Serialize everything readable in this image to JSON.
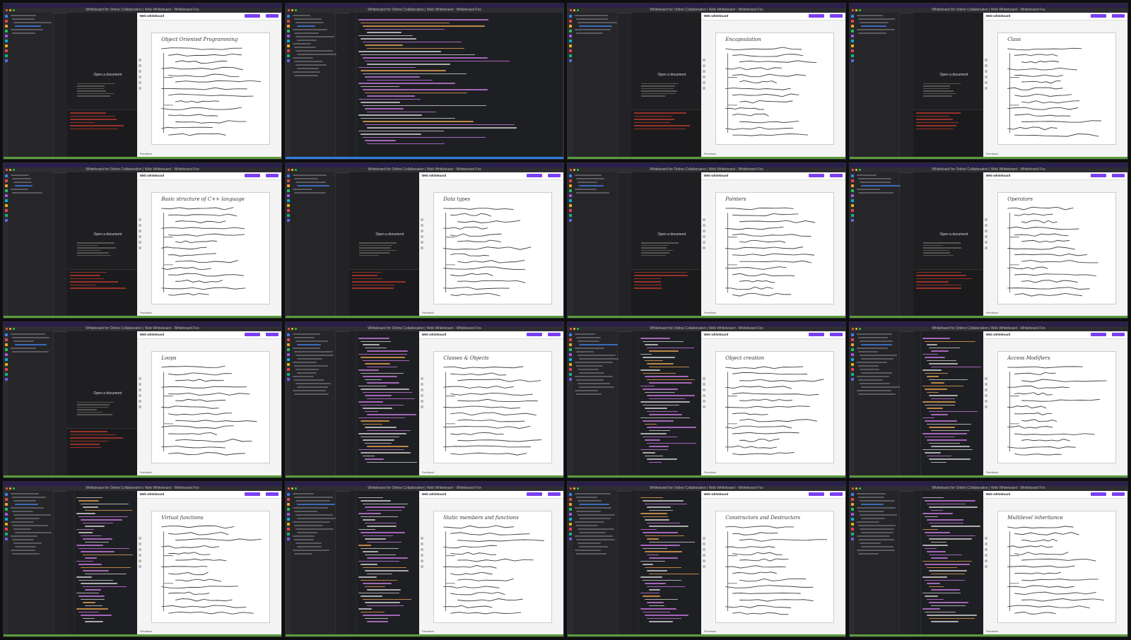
{
  "window_title": "Whiteboard for Online Collaboration | Web Whiteboard - Whiteboard Fox",
  "whiteboard": {
    "app_name": "Web whiteboard",
    "feedback_label": "Feedback"
  },
  "document_pane": {
    "prompt": "Open a document"
  },
  "ide": {
    "tab_name": "main.cpp",
    "project_name": "Env_OOP"
  },
  "tiles": [
    {
      "layout": "doc",
      "heading": "Object Oriented Programming"
    },
    {
      "layout": "ide-main",
      "heading": ""
    },
    {
      "layout": "doc",
      "heading": "Encapsulation"
    },
    {
      "layout": "doc",
      "heading": "Class"
    },
    {
      "layout": "doc",
      "heading": "Basic structure of C++ language"
    },
    {
      "layout": "doc",
      "heading": "Data types"
    },
    {
      "layout": "doc",
      "heading": "Pointers"
    },
    {
      "layout": "doc",
      "heading": "Operators"
    },
    {
      "layout": "doc",
      "heading": "Loops"
    },
    {
      "layout": "code",
      "heading": "Classes & Objects"
    },
    {
      "layout": "code",
      "heading": "Object creation"
    },
    {
      "layout": "code",
      "heading": "Access Modifiers"
    },
    {
      "layout": "code",
      "heading": "Virtual functions"
    },
    {
      "layout": "code",
      "heading": "Static members and functions"
    },
    {
      "layout": "code",
      "heading": "Constructors and Destructors"
    },
    {
      "layout": "code",
      "heading": "Multilevel inheritance"
    }
  ],
  "colors": {
    "accent_purple": "#7b3ff2",
    "status_green": "#5b9b3c",
    "status_blue": "#2f7de0",
    "code_keyword": "#c678dd",
    "code_string": "#e5a050",
    "code_text": "#cfcfcf"
  }
}
